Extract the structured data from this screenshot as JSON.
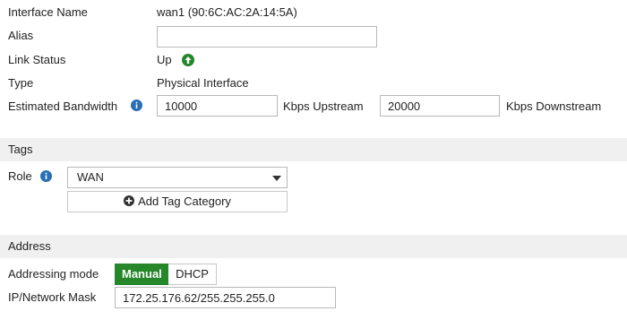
{
  "interface": {
    "name_label": "Interface Name",
    "name_value": "wan1 (90:6C:AC:2A:14:5A)",
    "alias_label": "Alias",
    "alias_value": "",
    "link_status_label": "Link Status",
    "link_status_value": "Up",
    "type_label": "Type",
    "type_value": "Physical Interface",
    "bandwidth_label": "Estimated Bandwidth",
    "upstream_value": "10000",
    "upstream_unit": "Kbps Upstream",
    "downstream_value": "20000",
    "downstream_unit": "Kbps Downstream"
  },
  "tags": {
    "section_title": "Tags",
    "role_label": "Role",
    "role_value": "WAN",
    "add_tag_label": "Add Tag Category"
  },
  "address": {
    "section_title": "Address",
    "mode_label": "Addressing mode",
    "mode_options": [
      "Manual",
      "DHCP"
    ],
    "mode_selected": "Manual",
    "ip_label": "IP/Network Mask",
    "ip_value": "172.25.176.62/255.255.255.0"
  },
  "colors": {
    "accent": "#25862a",
    "info": "#2a6fb5",
    "section_bg": "#f0f0f0"
  },
  "icons": [
    "info-icon",
    "link-up-icon",
    "caret-down-icon",
    "plus-circle-icon"
  ]
}
